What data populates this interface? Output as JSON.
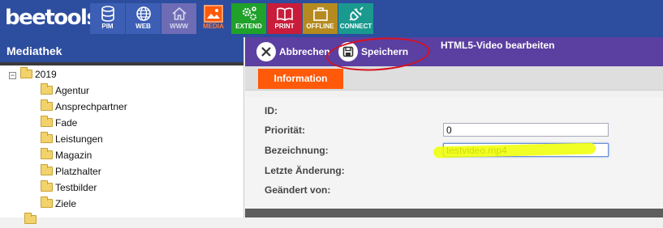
{
  "app": {
    "logo_text": "beetools",
    "modules": [
      {
        "label": "PIM",
        "icon": "database-icon",
        "color": "#3c5fb5"
      },
      {
        "label": "WEB",
        "icon": "globe-icon",
        "color": "#3c5fb5"
      },
      {
        "label": "WWW",
        "icon": "home-icon",
        "color": "#6d6cb4"
      },
      {
        "label": "MEDIA",
        "icon": "image-icon",
        "color": "#ff5a0a"
      },
      {
        "label": "EXTEND",
        "icon": "gears-icon",
        "color": "#1fa12a"
      },
      {
        "label": "PRINT",
        "icon": "book-icon",
        "color": "#c91c3b"
      },
      {
        "label": "OFFLINE",
        "icon": "briefcase-icon",
        "color": "#b58b1f"
      },
      {
        "label": "CONNECT",
        "icon": "plug-icon",
        "color": "#1a9a8f"
      }
    ]
  },
  "sidebar": {
    "title": "Mediathek",
    "root": {
      "label": "2019",
      "expander": "−"
    },
    "items": [
      "Agentur",
      "Ansprechpartner",
      "Fade",
      "Leistungen",
      "Magazin",
      "Platzhalter",
      "Testbilder",
      "Ziele"
    ]
  },
  "toolbar": {
    "cancel_label": "Abbrechen",
    "save_label": "Speichern",
    "form_title": "HTML5-Video bearbeiten"
  },
  "tabs": {
    "info_label": "Information"
  },
  "form": {
    "fields": [
      {
        "label": "ID:"
      },
      {
        "label": "Priorität:",
        "value": "0"
      },
      {
        "label": "Bezeichnung:",
        "value": "testvideo.mp4"
      },
      {
        "label": "Letzte Änderung:"
      },
      {
        "label": "Geändert von:"
      }
    ]
  },
  "colors": {
    "brand_blue": "#2d4d9e",
    "toolbar_purple": "#5b3fa1",
    "accent_orange": "#ff5a0a",
    "annotation_red": "#d6121e",
    "highlight_yellow": "#f0ff00"
  }
}
